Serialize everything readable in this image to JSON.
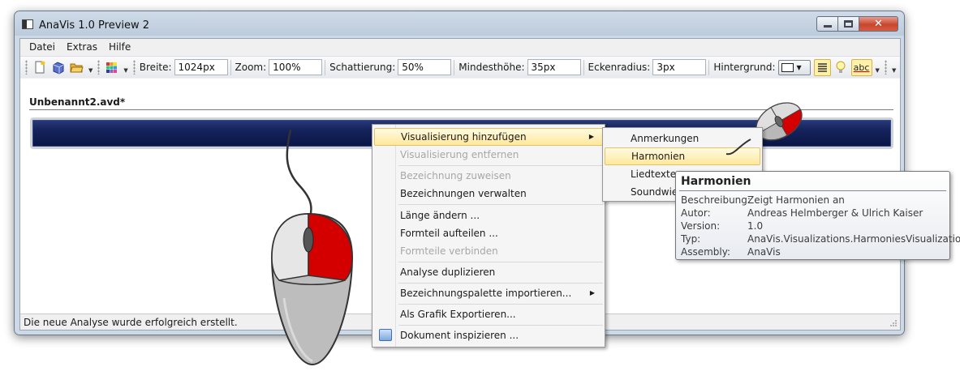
{
  "window": {
    "title": "AnaVis 1.0 Preview 2",
    "close_glyph": "✕"
  },
  "menubar": {
    "items": [
      "Datei",
      "Extras",
      "Hilfe"
    ]
  },
  "toolbar": {
    "icons": [
      "new-document-icon",
      "save-icon",
      "open-folder-icon",
      "palette-icon",
      "align-icon",
      "lightbulb-icon",
      "spellcheck-icon"
    ],
    "abc_label": "abc",
    "breite_label": "Breite:",
    "breite_value": "1024px",
    "zoom_label": "Zoom:",
    "zoom_value": "100%",
    "schattierung_label": "Schattierung:",
    "schattierung_value": "50%",
    "mindesthoehe_label": "Mindesthöhe:",
    "mindesthoehe_value": "35px",
    "eckenradius_label": "Eckenradius:",
    "eckenradius_value": "3px",
    "hintergrund_label": "Hintergrund:"
  },
  "document": {
    "title": "Unbenannt2.avd*"
  },
  "status": {
    "text": "Die neue Analyse wurde erfolgreich erstellt."
  },
  "context_menu": {
    "items": [
      {
        "label": "Visualisierung hinzufügen",
        "highlighted": true,
        "submenu": true
      },
      {
        "label": "Visualisierung entfernen",
        "disabled": true
      },
      {
        "label": "Bezeichnung zuweisen",
        "disabled": true
      },
      {
        "label": "Bezeichnungen verwalten"
      },
      {
        "label": "Länge ändern ..."
      },
      {
        "label": "Formteil aufteilen ..."
      },
      {
        "label": "Formteile verbinden",
        "disabled": true
      },
      {
        "label": "Analyse duplizieren"
      },
      {
        "label": "Bezeichnungspalette importieren...",
        "submenu": true
      },
      {
        "label": "Als Grafik Exportieren..."
      },
      {
        "label": "Dokument inspizieren ..."
      }
    ]
  },
  "submenu": {
    "items": [
      "Anmerkungen",
      "Harmonien",
      "Liedtexte",
      "Soundwie"
    ]
  },
  "tooltip": {
    "title": "Harmonien",
    "rows": [
      {
        "key": "Beschreibung:",
        "value": "Zeigt Harmonien an"
      },
      {
        "key": "Autor:",
        "value": "Andreas Helmberger & Ulrich Kaiser"
      },
      {
        "key": "Version:",
        "value": "1.0"
      },
      {
        "key": "Typ:",
        "value": "AnaVis.Visualizations.HarmoniesVisualization"
      },
      {
        "key": "Assembly:",
        "value": "AnaVis"
      }
    ]
  },
  "colors": {
    "timeline": "#16245e",
    "highlight": "#ffe89b",
    "mouse_button": "#d40000"
  }
}
